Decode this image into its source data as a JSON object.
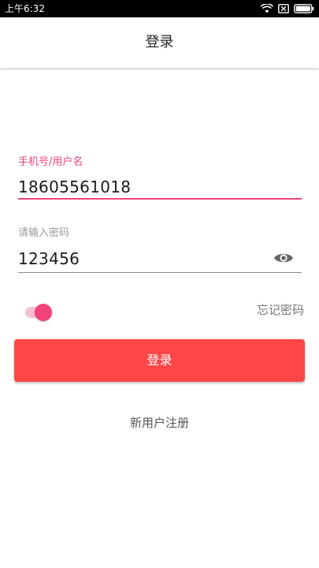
{
  "status_bar": {
    "time": "上午6:32",
    "icons": [
      "wifi-icon",
      "sim-card-disabled-icon",
      "battery-icon"
    ]
  },
  "app_bar": {
    "title": "登录"
  },
  "username_field": {
    "label": "手机号/用户名",
    "value": "18605561018",
    "focused": true
  },
  "password_field": {
    "label": "请输入密码",
    "value": "123456",
    "toggle_icon": "eye-icon"
  },
  "remember_switch": {
    "on": true
  },
  "forgot_password": {
    "label": "忘记密码"
  },
  "login_button": {
    "label": "登录"
  },
  "register": {
    "label": "新用户注册"
  },
  "colors": {
    "accent": "#f0437a",
    "button": "#ff4646",
    "switch_track": "#f7bfd2",
    "status_bar": "#000000"
  }
}
